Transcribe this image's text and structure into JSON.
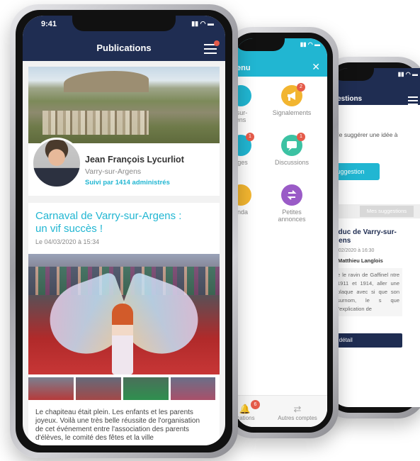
{
  "phone_front": {
    "time": "9:41",
    "header_title": "Publications",
    "profile": {
      "name": "Jean François Lycurliot",
      "town": "Varry-sur-Argens",
      "followers": "Suivi par 1414 administrés"
    },
    "post": {
      "title": "Carnaval de Varry-sur-Argens : un vif succès !",
      "date": "Le 04/03/2020 à 15:34",
      "text": "Le chapiteau était plein. Les enfants et les parents joyeux. Voilà une très belle réussite de l'organisation de cet événement entre l'association des parents d'élèves, le comité des fêtes et la ville"
    }
  },
  "phone_middle": {
    "header_title": "enu",
    "menu_items": [
      {
        "label": "-sur-\nens",
        "icon": "city-icon",
        "color": "#21b6d2",
        "badge": ""
      },
      {
        "label": "Signalements",
        "icon": "megaphone-icon",
        "color": "#f2b530",
        "badge": "2"
      },
      {
        "label": "ages",
        "icon": "message-icon",
        "color": "#21b6d2",
        "badge": "1"
      },
      {
        "label": "Discussions",
        "icon": "chat-icon",
        "color": "#3cc2a3",
        "badge": "1"
      },
      {
        "label": "enda",
        "icon": "calendar-icon",
        "color": "#f2b530",
        "badge": ""
      },
      {
        "label": "Petites\nannonces",
        "icon": "exchange-icon",
        "color": "#9a5bc7",
        "badge": ""
      }
    ],
    "bottom_left_label": "ications",
    "bottom_left_badge": "6",
    "bottom_right_label": "Autres comptes"
  },
  "phone_back": {
    "header_title": "gestions",
    "intro": "de suggérer une idée à",
    "suggestion_button": "suggestion",
    "tab_mine": "Mes suggestions",
    "card": {
      "title": "aduc de Varry-sur-gens",
      "date": "9/02/2020 à 16:30",
      "author": "r Matthieu Langlois",
      "text": "e le ravin de Gaffinel ntre 1911 et 1914, aller une plaque avec si que son surnom, le s que l'explication de"
    },
    "detail_button": "e détail"
  },
  "colors": {
    "navy": "#1f2d52",
    "cyan": "#21b6d2",
    "red_badge": "#e55b4a"
  }
}
